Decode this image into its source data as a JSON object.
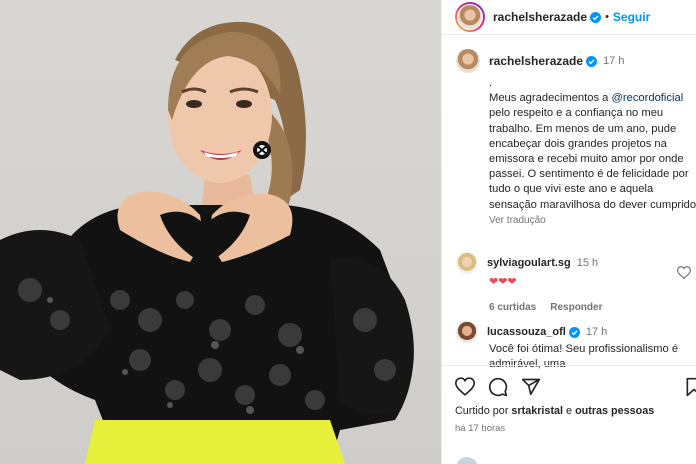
{
  "header": {
    "username": "rachelsherazade",
    "separator": "•",
    "follow_label": "Seguir"
  },
  "caption": {
    "username": "rachelsherazade",
    "time": "17 h",
    "dot_line": ".",
    "text_before_mention": "Meus agradecimentos a ",
    "mention": "@recordoficial",
    "text_after_mention": " pelo respeito e a confiança no meu trabalho. Em menos de um ano, pude encabeçar dois grandes projetos na emissora e recebi muito amor por onde passei. O sentimento é de felicidade por tudo o que vivi este ano e aquela sensação maravilhosa do dever cumprido",
    "translate_label": "Ver tradução"
  },
  "comments": [
    {
      "username": "sylviagoulart.sg",
      "time": "15 h",
      "text": "❤❤❤",
      "likes": "6 curtidas",
      "reply_label": "Responder"
    },
    {
      "username": "lucassouza_ofl",
      "time": "17 h",
      "text": "Você foi ótima! Seu profissionalismo é admirável, uma"
    }
  ],
  "actions": {
    "like_icon": "heart-icon",
    "comment_icon": "comment-icon",
    "share_icon": "share-icon",
    "save_icon": "bookmark-icon"
  },
  "likes_line": {
    "prefix": "Curtido por ",
    "user": "srtakristal",
    "connector": " e ",
    "others": "outras pessoas"
  },
  "post_age": "há 17 horas",
  "colors": {
    "accent": "#0095f6",
    "heart": "#ed4956",
    "verified": "#0095f6",
    "sweater": "#111111",
    "skirt": "#e6f03a"
  }
}
